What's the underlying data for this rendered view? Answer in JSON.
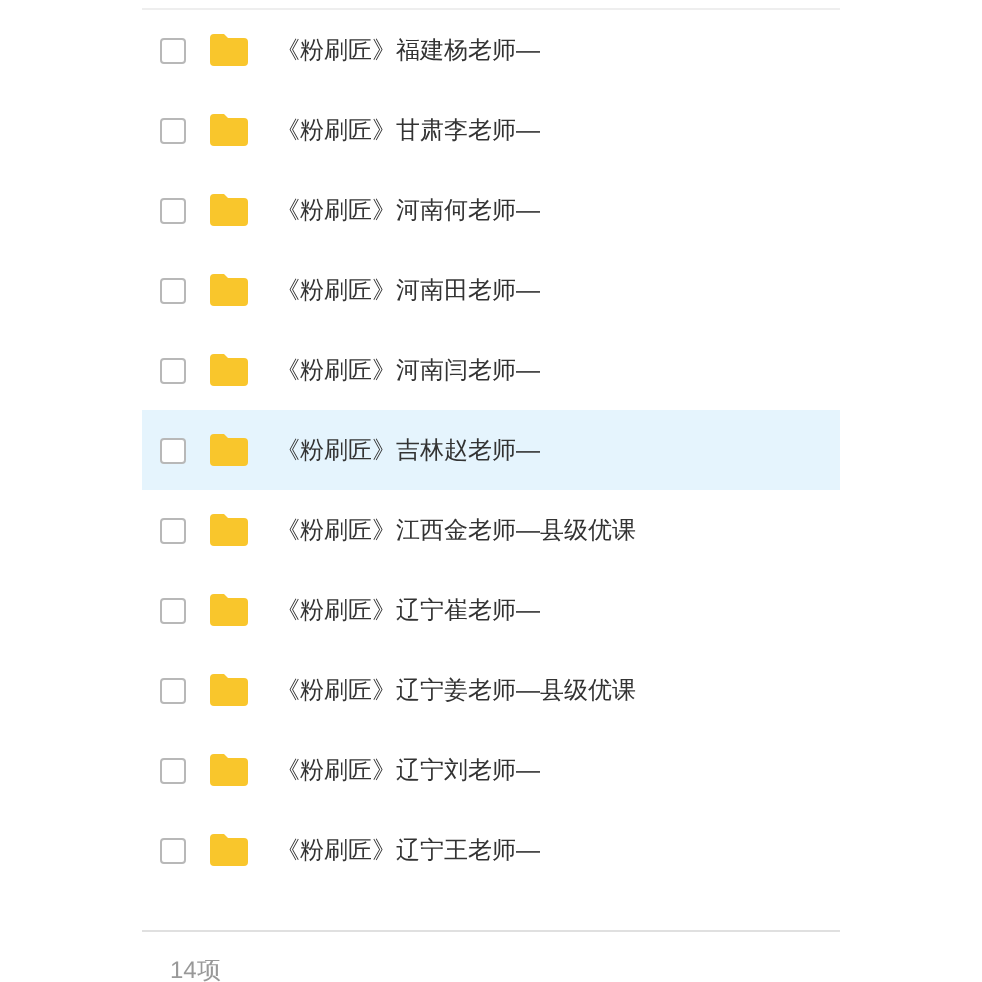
{
  "rows": [
    {
      "name": "《粉刷匠》福建杨老师—",
      "checked": false,
      "selected": false
    },
    {
      "name": "《粉刷匠》甘肃李老师—",
      "checked": false,
      "selected": false
    },
    {
      "name": "《粉刷匠》河南何老师—",
      "checked": false,
      "selected": false
    },
    {
      "name": "《粉刷匠》河南田老师—",
      "checked": false,
      "selected": false
    },
    {
      "name": "《粉刷匠》河南闫老师—",
      "checked": false,
      "selected": false
    },
    {
      "name": "《粉刷匠》吉林赵老师—",
      "checked": false,
      "selected": true
    },
    {
      "name": "《粉刷匠》江西金老师—县级优课",
      "checked": false,
      "selected": false
    },
    {
      "name": "《粉刷匠》辽宁崔老师—",
      "checked": false,
      "selected": false
    },
    {
      "name": "《粉刷匠》辽宁姜老师—县级优课",
      "checked": false,
      "selected": false
    },
    {
      "name": "《粉刷匠》辽宁刘老师—",
      "checked": false,
      "selected": false
    },
    {
      "name": "《粉刷匠》辽宁王老师—",
      "checked": false,
      "selected": false
    }
  ],
  "footer": {
    "count": "14项"
  }
}
